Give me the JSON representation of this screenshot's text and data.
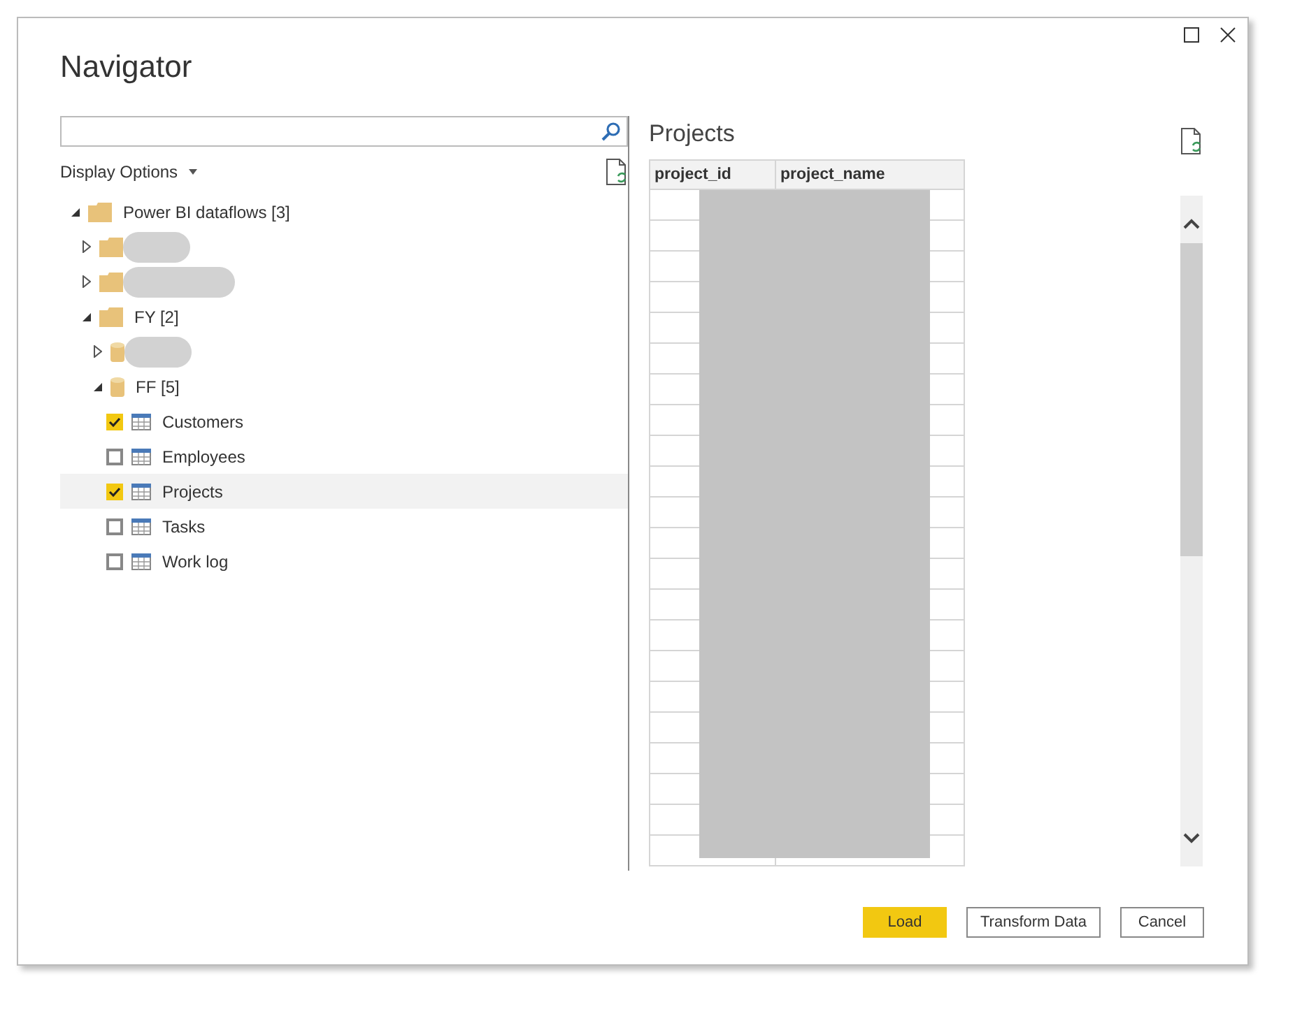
{
  "window": {
    "title": "Navigator"
  },
  "display_options": {
    "label": "Display Options"
  },
  "tree": [
    {
      "kind": "folder",
      "label": "Power BI dataflows [3]",
      "expanded": true,
      "children": [
        {
          "kind": "folder",
          "redacted": true,
          "expanded": false
        },
        {
          "kind": "folder",
          "redacted": true,
          "expanded": false
        },
        {
          "kind": "folder",
          "label": "FY [2]",
          "expanded": true,
          "children": [
            {
              "kind": "database",
              "redacted": true,
              "expanded": false
            },
            {
              "kind": "database",
              "label": "FF [5]",
              "expanded": true,
              "children": [
                {
                  "kind": "table",
                  "label": "Customers",
                  "checked": true,
                  "selected": false
                },
                {
                  "kind": "table",
                  "label": "Employees",
                  "checked": false,
                  "selected": false
                },
                {
                  "kind": "table",
                  "label": "Projects",
                  "checked": true,
                  "selected": true
                },
                {
                  "kind": "table",
                  "label": "Tasks",
                  "checked": false,
                  "selected": false
                },
                {
                  "kind": "table",
                  "label": "Work log",
                  "checked": false,
                  "selected": false
                }
              ]
            }
          ]
        }
      ]
    }
  ],
  "preview": {
    "title": "Projects",
    "columns": [
      "project_id",
      "project_name"
    ]
  },
  "buttons": [
    {
      "label": "Load",
      "kind": "primary"
    },
    {
      "label": "Transform Data",
      "kind": "secondary"
    },
    {
      "label": "Cancel",
      "kind": "secondary"
    }
  ]
}
